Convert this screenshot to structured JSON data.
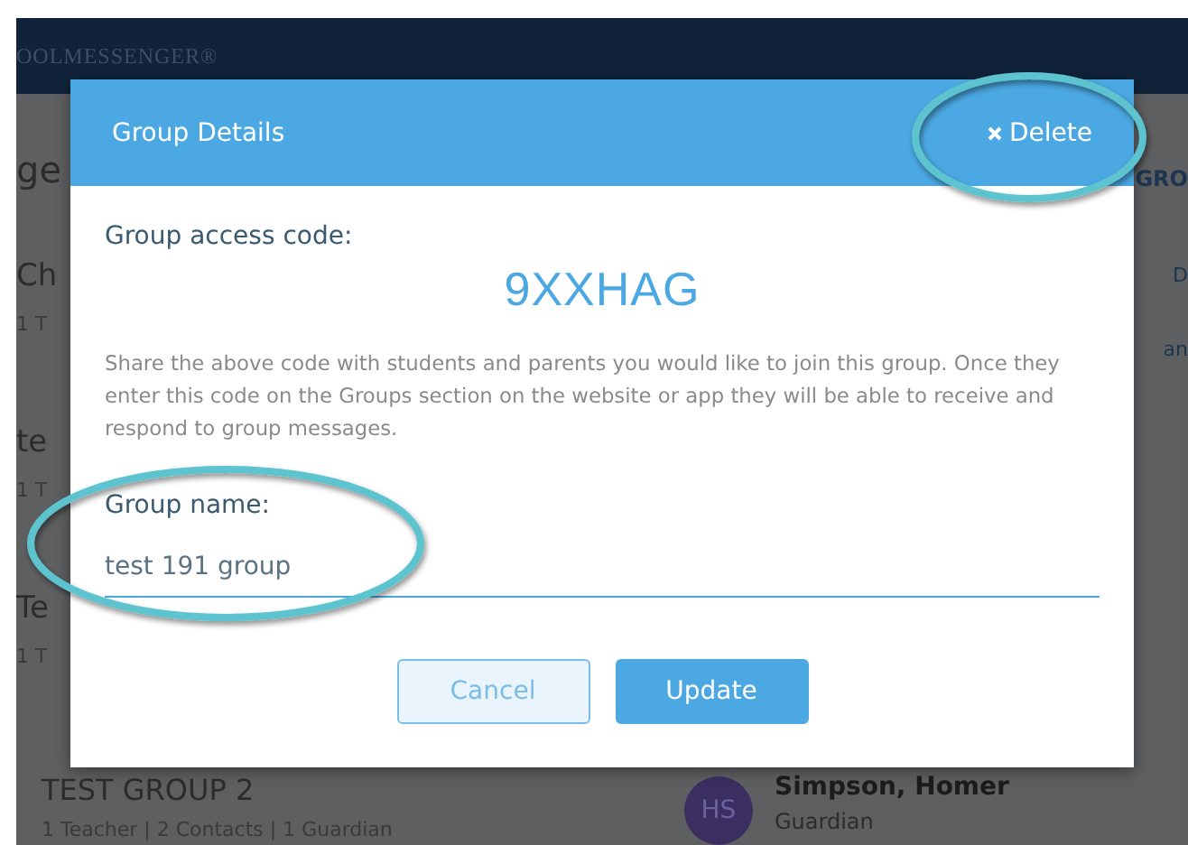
{
  "app_header": {
    "brand": "OOLMESSENGER®"
  },
  "background": {
    "page_title": "ge",
    "right_tab": "GRO",
    "left_fragments": [
      {
        "title": "Ch",
        "meta": "1 T"
      },
      {
        "title": "te",
        "meta": "1 T"
      },
      {
        "title": "Te",
        "meta": "1 T"
      }
    ],
    "right_fragments": [
      "D",
      "an"
    ],
    "group": {
      "title": "TEST GROUP 2",
      "meta": "1 Teacher | 2 Contacts | 1 Guardian",
      "member": {
        "initials": "HS",
        "name": "Simpson, Homer",
        "role": "Guardian"
      }
    }
  },
  "dialog": {
    "title": "Group Details",
    "delete_label": "Delete",
    "code_label": "Group access code:",
    "code": "9XXHAG",
    "description": "Share the above code with students and parents you would like to join this group. Once they enter this code on the Groups section on the website or app they will be able to receive and respond to group messages.",
    "name_label": "Group name:",
    "name_value": "test 191 group",
    "buttons": [
      {
        "label": "Cancel",
        "kind": "secondary"
      },
      {
        "label": "Update",
        "kind": "primary"
      }
    ]
  },
  "annotations": [
    {
      "kind": "ellipse"
    },
    {
      "kind": "ellipse"
    }
  ]
}
